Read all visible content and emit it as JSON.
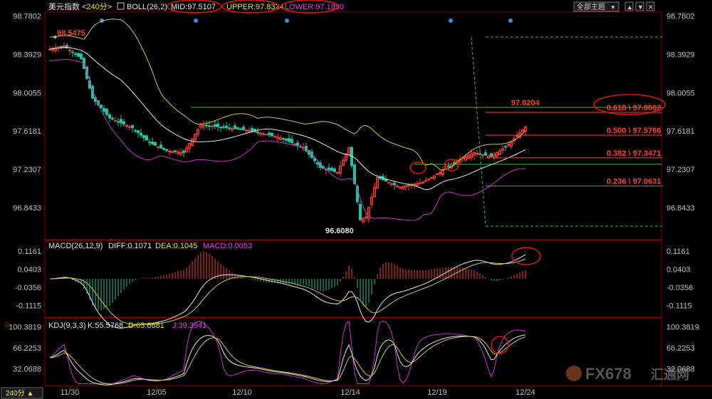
{
  "header": {
    "instrument": "美元指数",
    "period": "<240分>",
    "boll_label": "BOLL(26,2)",
    "mid": "MID:97.5107",
    "upper": "UPPER:97.8324",
    "lower": "LOWER:97.1890",
    "topics_button": "全部主题"
  },
  "price_axis": {
    "ticks": [
      {
        "value": 98.7802,
        "label": "98.7802"
      },
      {
        "value": 98.3929,
        "label": "98.3929"
      },
      {
        "value": 98.0055,
        "label": "98.0055"
      },
      {
        "value": 97.6181,
        "label": "97.6181"
      },
      {
        "value": 97.2307,
        "label": "97.2307"
      },
      {
        "value": 96.8433,
        "label": "96.8433"
      }
    ],
    "ylim": [
      96.52,
      98.82
    ]
  },
  "annotations": {
    "high": "98.5475",
    "low": "96.6080",
    "recent_high": "97.8204"
  },
  "fibonacci": [
    {
      "label": "0.618 \\ 97.8062",
      "value": 97.8062,
      "color": "#ff3b3b"
    },
    {
      "label": "0.500 \\ 97.5766",
      "value": 97.5766,
      "color": "#ff3b3b"
    },
    {
      "label": "0.382 \\ 97.3471",
      "value": 97.3471,
      "color": "#ff3b3b"
    },
    {
      "label": "0.236 \\ 97.0631",
      "value": 97.0631,
      "color": "#ff3b3b"
    }
  ],
  "macd": {
    "header_name": "MACD(26,12,9)",
    "diff": "DIFF:0.1071",
    "dea": "DEA:0.1045",
    "macd": "MACD:0.0053",
    "ticks": [
      {
        "value": 0.1161,
        "label": "0.1161"
      },
      {
        "value": 0.0403,
        "label": "0.0403"
      },
      {
        "value": -0.0356,
        "label": "-0.0356"
      },
      {
        "value": -0.1115,
        "label": "-0.1115"
      }
    ],
    "ylim": [
      -0.16,
      0.16
    ]
  },
  "kdj": {
    "header_name": "KDJ(9,3,3)",
    "k": "K:55.5768",
    "d": "D:63.6681",
    "j": "J:39.3941",
    "ticks": [
      {
        "value": 100.3819,
        "label": "100.3819"
      },
      {
        "value": 66.2253,
        "label": "66.2253"
      },
      {
        "value": 32.0688,
        "label": "32.0688"
      }
    ],
    "ylim": [
      5,
      115
    ]
  },
  "x_axis": {
    "dates": [
      "11/30",
      "12/05",
      "12/10",
      "12/14",
      "12/19",
      "12/24"
    ],
    "period_button": "240分 ▲"
  },
  "watermark": {
    "text": "FX678",
    "cn": "汇通网"
  },
  "colors": {
    "up": "#ff3b3b",
    "down": "#22c4a0",
    "mid": "#e8e8e8",
    "upper": "#d4c832",
    "lower": "#c832c8",
    "diff": "#e8e8e8",
    "dea": "#d4c832",
    "k": "#e8e8e8",
    "d": "#d4c832",
    "j": "#c832c8",
    "fib_green": "#22c83c",
    "circle": "#e01414",
    "header_title": "#e0e0e0",
    "header_mid": "#e8e8e8",
    "header_upper": "#e8e820",
    "header_lower": "#e040e0",
    "header_macd_diff": "#e8e8e8",
    "header_macd_dea": "#e8e820",
    "header_macd_macd": "#e040e0"
  },
  "chart_data": {
    "type": "line",
    "title": "",
    "xlabel": "",
    "ylabel": "",
    "x": [
      "11/30",
      "12/05",
      "12/10",
      "12/14",
      "12/19",
      "12/24"
    ],
    "series": [
      {
        "name": "MID",
        "values": [
          98.35,
          97.95,
          97.55,
          97.25,
          97.25,
          97.55
        ]
      },
      {
        "name": "UPPER",
        "values": [
          98.55,
          98.05,
          97.75,
          97.55,
          97.45,
          97.8324
        ]
      },
      {
        "name": "LOWER",
        "values": [
          98.1,
          97.45,
          97.2,
          96.75,
          96.8,
          97.189
        ]
      }
    ],
    "ylim": [
      96.52,
      98.82
    ],
    "grid": false,
    "legend": "top-left"
  }
}
